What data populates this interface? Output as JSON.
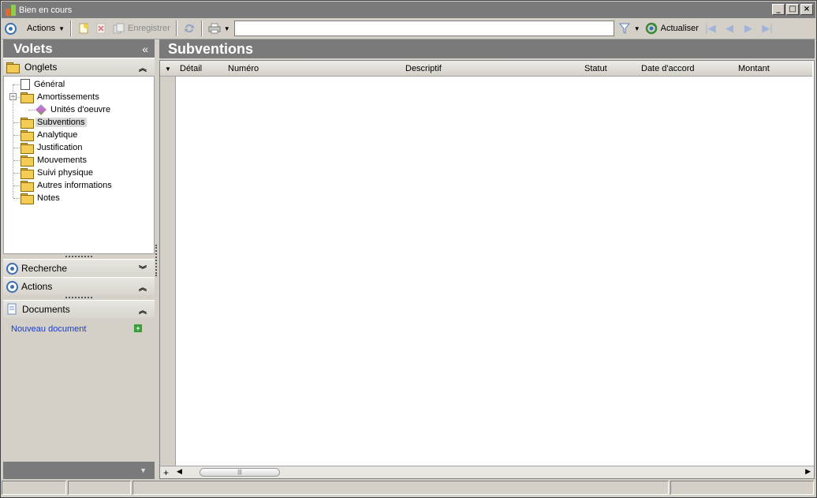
{
  "window": {
    "title": "Bien en cours"
  },
  "toolbar": {
    "actions_label": "Actions",
    "save_label": "Enregistrer",
    "refresh_label": "Actualiser",
    "search_value": ""
  },
  "left": {
    "header": "Volets",
    "collapse_glyph": "«",
    "onglets_label": "Onglets",
    "tree": [
      {
        "label": "Général",
        "icon": "document-icon",
        "level": 1
      },
      {
        "label": "Amortissements",
        "icon": "folder-icon",
        "level": 1,
        "expanded": true
      },
      {
        "label": "Unités d'oeuvre",
        "icon": "gear-icon",
        "level": 2
      },
      {
        "label": "Subventions",
        "icon": "folder-open-icon",
        "level": 1,
        "selected": true
      },
      {
        "label": "Analytique",
        "icon": "folder-icon",
        "level": 1
      },
      {
        "label": "Justification",
        "icon": "folder-icon",
        "level": 1
      },
      {
        "label": "Mouvements",
        "icon": "folder-icon",
        "level": 1
      },
      {
        "label": "Suivi physique",
        "icon": "folder-icon",
        "level": 1
      },
      {
        "label": "Autres informations",
        "icon": "folder-icon",
        "level": 1
      },
      {
        "label": "Notes",
        "icon": "folder-icon",
        "level": 1
      }
    ],
    "recherche_label": "Recherche",
    "actions_label": "Actions",
    "documents_label": "Documents",
    "new_document_label": "Nouveau document"
  },
  "right": {
    "header": "Subventions",
    "columns": [
      "Détail",
      "Numéro",
      "Descriptif",
      "Statut",
      "Date d'accord",
      "Montant"
    ]
  },
  "colors": {
    "accent": "#3b6fb6",
    "header_bg": "#7a7a7a",
    "link": "#1a3cc8"
  }
}
